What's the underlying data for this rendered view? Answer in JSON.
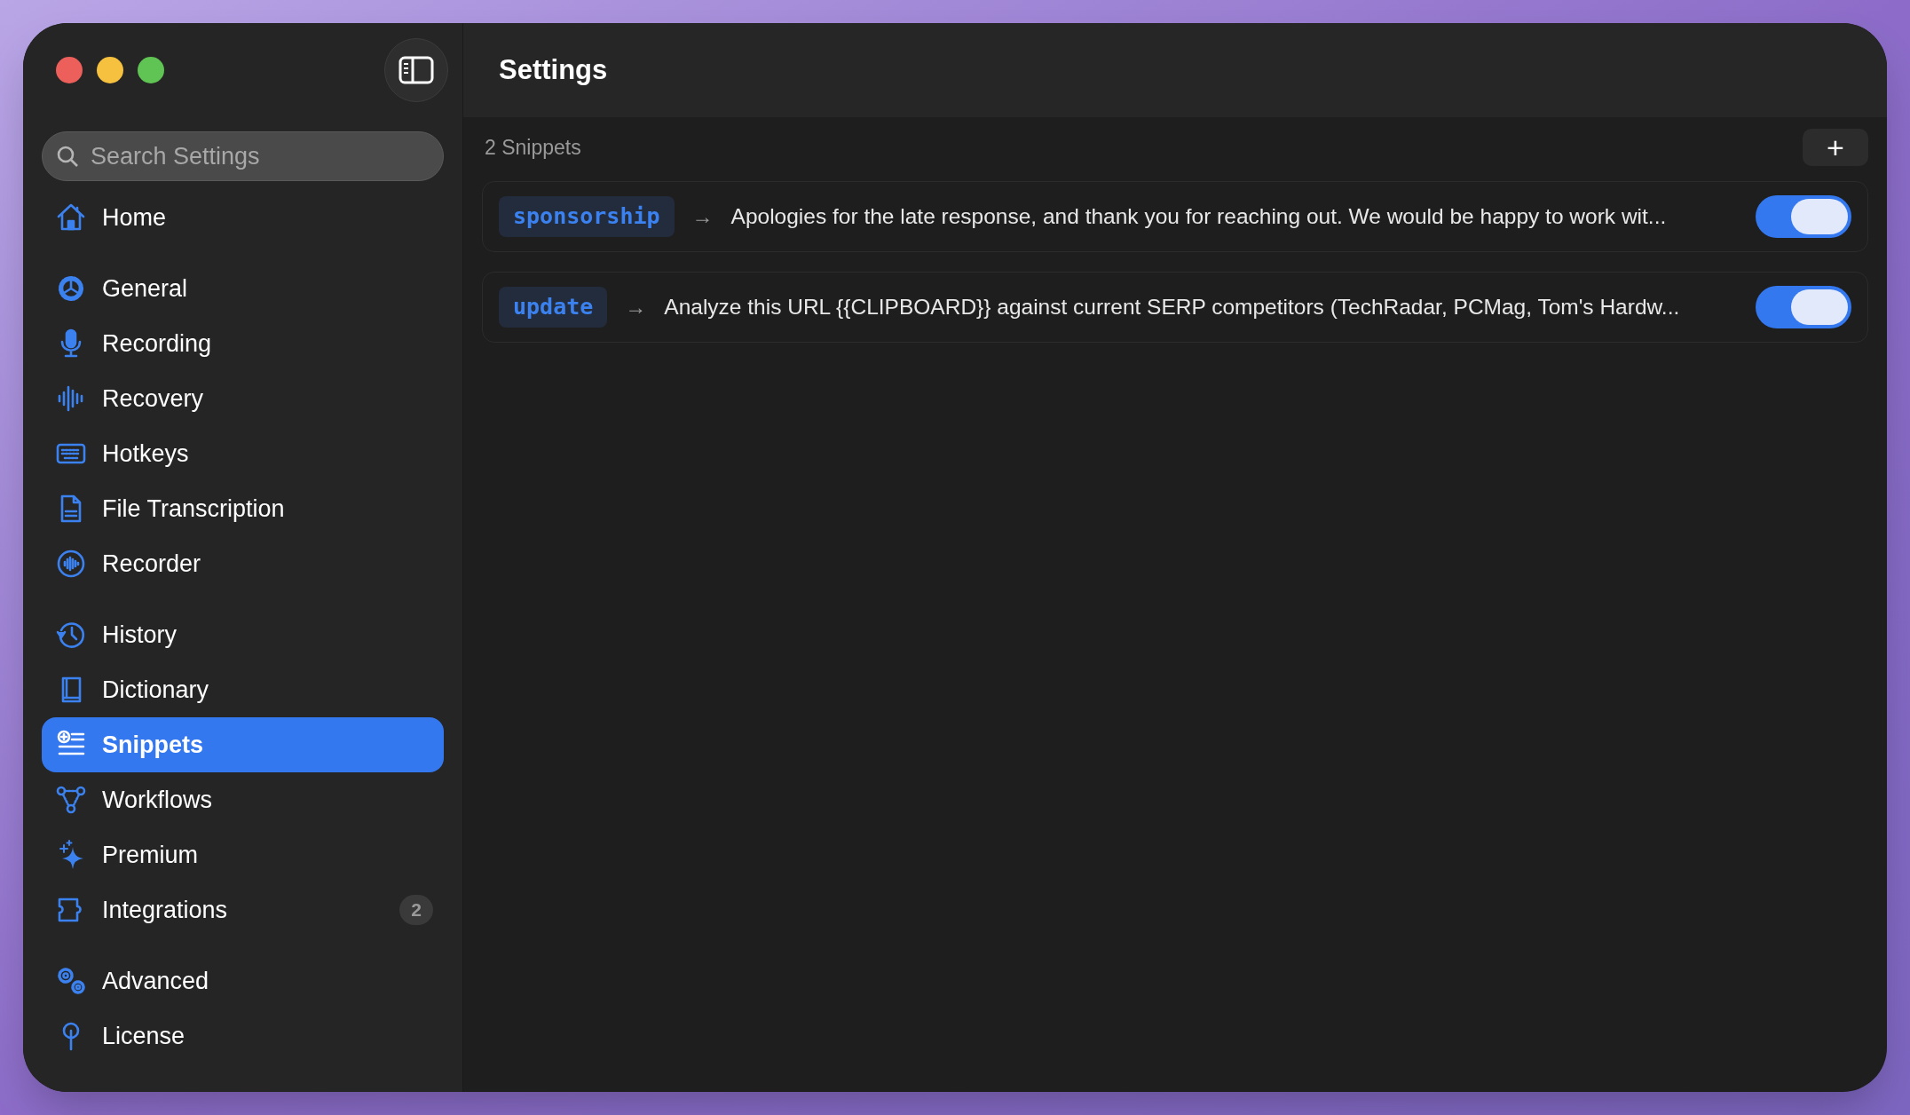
{
  "window": {
    "title": "Settings"
  },
  "sidebar": {
    "search": {
      "placeholder": "Search Settings"
    },
    "groups": [
      {
        "items": [
          {
            "label": "Home",
            "selected": false
          }
        ]
      },
      {
        "items": [
          {
            "label": "General",
            "selected": false
          },
          {
            "label": "Recording",
            "selected": false
          },
          {
            "label": "Recovery",
            "selected": false
          },
          {
            "label": "Hotkeys",
            "selected": false
          },
          {
            "label": "File Transcription",
            "selected": false
          },
          {
            "label": "Recorder",
            "selected": false
          }
        ]
      },
      {
        "items": [
          {
            "label": "History",
            "selected": false
          },
          {
            "label": "Dictionary",
            "selected": false
          },
          {
            "label": "Snippets",
            "selected": true
          },
          {
            "label": "Workflows",
            "selected": false
          },
          {
            "label": "Premium",
            "selected": false
          },
          {
            "label": "Integrations",
            "selected": false,
            "badge": "2"
          }
        ]
      },
      {
        "items": [
          {
            "label": "Advanced",
            "selected": false
          },
          {
            "label": "License",
            "selected": false
          }
        ]
      }
    ]
  },
  "snippets": {
    "count": "2 Snippets",
    "add_button": "+",
    "items": [
      {
        "trigger": "sponsorship",
        "arrow": "→",
        "text": "Apologies for the late response, and thank you for reaching out. We would be happy to work wit...",
        "on": true
      },
      {
        "trigger": "update",
        "arrow": "→",
        "text": "Analyze this URL {{CLIPBOARD}} against current SERP competitors (TechRadar, PCMag, Tom's Hardw...",
        "on": true
      }
    ]
  }
}
